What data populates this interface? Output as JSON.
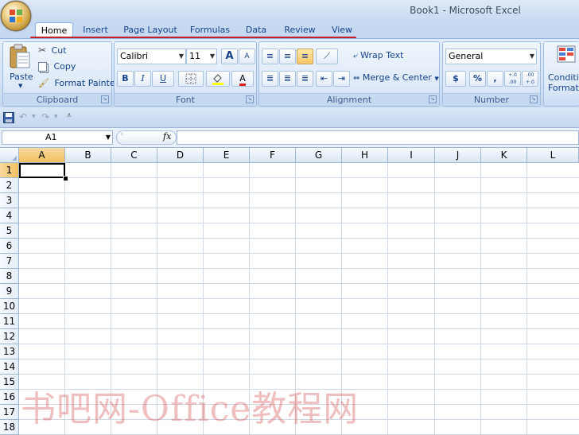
{
  "window": {
    "title": "Book1 - Microsoft Excel"
  },
  "tabs": [
    {
      "label": "Home",
      "active": true
    },
    {
      "label": "Insert"
    },
    {
      "label": "Page Layout"
    },
    {
      "label": "Formulas"
    },
    {
      "label": "Data"
    },
    {
      "label": "Review"
    },
    {
      "label": "View"
    }
  ],
  "clipboard": {
    "group_label": "Clipboard",
    "paste": "Paste",
    "cut": "Cut",
    "copy": "Copy",
    "format_painter": "Format Painter"
  },
  "font": {
    "group_label": "Font",
    "family": "Calibri",
    "size": "11",
    "bold": "B",
    "italic": "I",
    "underline": "U",
    "grow": "A",
    "shrink": "A",
    "font_color": "A"
  },
  "alignment": {
    "group_label": "Alignment",
    "wrap_text": "Wrap Text",
    "merge_center": "Merge & Center"
  },
  "number": {
    "group_label": "Number",
    "format": "General",
    "currency": "$",
    "percent": "%",
    "comma": ",",
    "inc_decimal": "+.0 .00",
    "dec_decimal": ".00 +.0"
  },
  "styles": {
    "conditional_formatting_line1": "Conditic",
    "conditional_formatting_line2": "Formattin"
  },
  "formula_bar": {
    "name_box": "A1",
    "fx": "fx",
    "formula": ""
  },
  "columns": [
    "A",
    "B",
    "C",
    "D",
    "E",
    "F",
    "G",
    "H",
    "I",
    "J",
    "K",
    "L"
  ],
  "rows": [
    "1",
    "2",
    "3",
    "4",
    "5",
    "6",
    "7",
    "8",
    "9",
    "10",
    "11",
    "12",
    "13",
    "14",
    "15",
    "16",
    "17",
    "18"
  ],
  "selected_cell": "A1",
  "watermark": "书吧网-Office教程网",
  "colors": {
    "accent": "#15428b",
    "tab_underline": "#c8202a",
    "ribbon": "#d5e3f5",
    "selected_header": "#f1c15f"
  },
  "icons": [
    "office-button-icon",
    "paste-icon",
    "scissors-icon",
    "copy-icon",
    "paintbrush-icon",
    "borders-icon",
    "fill-color-icon",
    "save-icon",
    "undo-icon",
    "redo-icon",
    "customize-qat-icon"
  ]
}
